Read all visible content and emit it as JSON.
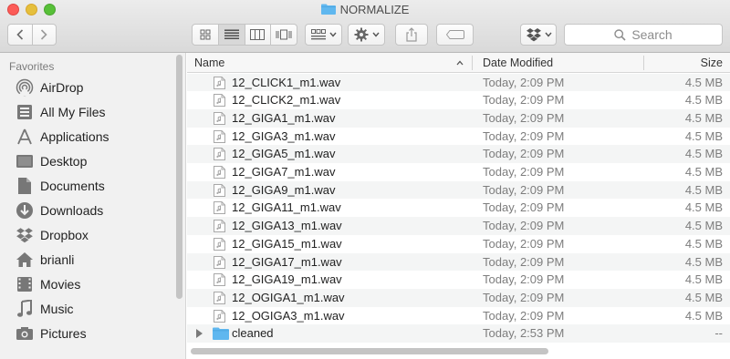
{
  "window": {
    "title": "NORMALIZE"
  },
  "toolbar": {
    "search_placeholder": "Search"
  },
  "sidebar": {
    "heading": "Favorites",
    "items": [
      {
        "label": "AirDrop",
        "icon": "airdrop-icon"
      },
      {
        "label": "All My Files",
        "icon": "all-my-files-icon"
      },
      {
        "label": "Applications",
        "icon": "applications-icon"
      },
      {
        "label": "Desktop",
        "icon": "desktop-icon"
      },
      {
        "label": "Documents",
        "icon": "documents-icon"
      },
      {
        "label": "Downloads",
        "icon": "downloads-icon"
      },
      {
        "label": "Dropbox",
        "icon": "dropbox-icon"
      },
      {
        "label": "brianli",
        "icon": "home-icon"
      },
      {
        "label": "Movies",
        "icon": "movies-icon"
      },
      {
        "label": "Music",
        "icon": "music-icon"
      },
      {
        "label": "Pictures",
        "icon": "pictures-icon"
      }
    ]
  },
  "list": {
    "columns": {
      "name": "Name",
      "date": "Date Modified",
      "size": "Size"
    },
    "rows": [
      {
        "name": "12_CLICK1_m1.wav",
        "date": "Today, 2:09 PM",
        "size": "4.5 MB"
      },
      {
        "name": "12_CLICK2_m1.wav",
        "date": "Today, 2:09 PM",
        "size": "4.5 MB"
      },
      {
        "name": "12_GIGA1_m1.wav",
        "date": "Today, 2:09 PM",
        "size": "4.5 MB"
      },
      {
        "name": "12_GIGA3_m1.wav",
        "date": "Today, 2:09 PM",
        "size": "4.5 MB"
      },
      {
        "name": "12_GIGA5_m1.wav",
        "date": "Today, 2:09 PM",
        "size": "4.5 MB"
      },
      {
        "name": "12_GIGA7_m1.wav",
        "date": "Today, 2:09 PM",
        "size": "4.5 MB"
      },
      {
        "name": "12_GIGA9_m1.wav",
        "date": "Today, 2:09 PM",
        "size": "4.5 MB"
      },
      {
        "name": "12_GIGA11_m1.wav",
        "date": "Today, 2:09 PM",
        "size": "4.5 MB"
      },
      {
        "name": "12_GIGA13_m1.wav",
        "date": "Today, 2:09 PM",
        "size": "4.5 MB"
      },
      {
        "name": "12_GIGA15_m1.wav",
        "date": "Today, 2:09 PM",
        "size": "4.5 MB"
      },
      {
        "name": "12_GIGA17_m1.wav",
        "date": "Today, 2:09 PM",
        "size": "4.5 MB"
      },
      {
        "name": "12_GIGA19_m1.wav",
        "date": "Today, 2:09 PM",
        "size": "4.5 MB"
      },
      {
        "name": "12_OGIGA1_m1.wav",
        "date": "Today, 2:09 PM",
        "size": "4.5 MB"
      },
      {
        "name": "12_OGIGA3_m1.wav",
        "date": "Today, 2:09 PM",
        "size": "4.5 MB"
      }
    ],
    "folder": {
      "name": "cleaned",
      "date": "Today, 2:53 PM",
      "size": "--"
    }
  },
  "colors": {
    "folder": "#5fb7ef",
    "traffic_close": "#fc5b57",
    "traffic_min": "#e5bf3c",
    "traffic_max": "#57c038"
  }
}
